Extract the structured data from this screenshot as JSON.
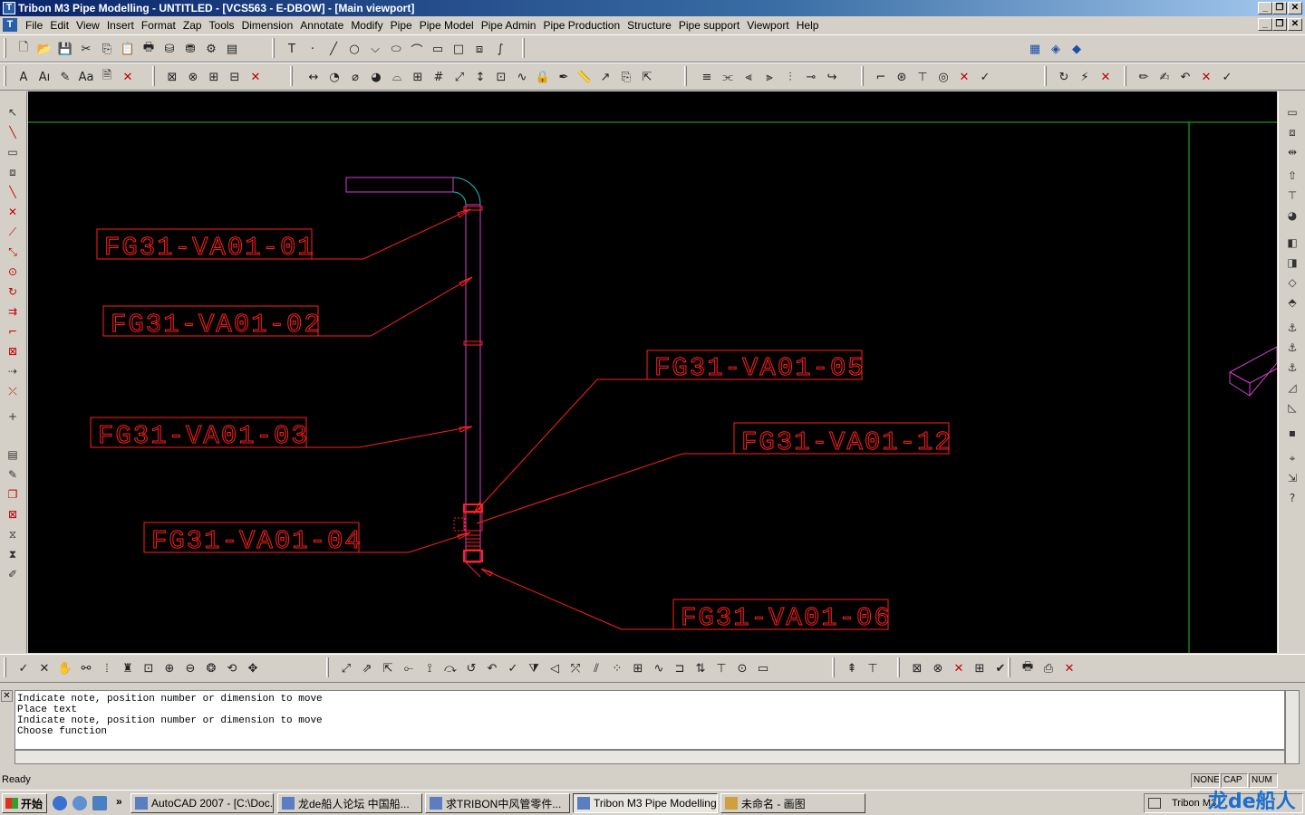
{
  "window": {
    "title": "Tribon M3 Pipe Modelling - UNTITLED - [VCS563 - E-DBOW] - [Main viewport]",
    "min": "_",
    "restore": "❐",
    "close": "✕"
  },
  "menu": {
    "items": [
      {
        "label": "File"
      },
      {
        "label": "Edit"
      },
      {
        "label": "View"
      },
      {
        "label": "Insert"
      },
      {
        "label": "Format"
      },
      {
        "label": "Zap"
      },
      {
        "label": "Tools"
      },
      {
        "label": "Dimension"
      },
      {
        "label": "Annotate"
      },
      {
        "label": "Modify"
      },
      {
        "label": "Pipe"
      },
      {
        "label": "Pipe Model"
      },
      {
        "label": "Pipe Admin"
      },
      {
        "label": "Pipe Production"
      },
      {
        "label": "Structure"
      },
      {
        "label": "Pipe support"
      },
      {
        "label": "Viewport"
      },
      {
        "label": "Help"
      }
    ]
  },
  "drawing": {
    "labels": [
      {
        "id": "fg31-va01-01",
        "text": "FG31-VA01-01"
      },
      {
        "id": "fg31-va01-02",
        "text": "FG31-VA01-02"
      },
      {
        "id": "fg31-va01-03",
        "text": "FG31-VA01-03"
      },
      {
        "id": "fg31-va01-04",
        "text": "FG31-VA01-04"
      },
      {
        "id": "fg31-va01-05",
        "text": "FG31-VA01-05"
      },
      {
        "id": "fg31-va01-12",
        "text": "FG31-VA01-12"
      },
      {
        "id": "fg31-va01-06",
        "text": "FG31-VA01-06"
      }
    ],
    "colors": {
      "label": "#ff2020",
      "pipe": "#d040d0",
      "bend": "#20c0c0",
      "border": "#20c020",
      "background": "#000000"
    }
  },
  "command": {
    "lines": [
      "Indicate note, position number or dimension to move",
      "Place text",
      "Indicate note, position number or dimension to move",
      "Choose function"
    ]
  },
  "status": {
    "text": "Ready",
    "panes": [
      "NONE",
      "CAP",
      "NUM"
    ]
  },
  "taskbar": {
    "start": "开始",
    "tasks": [
      {
        "label": "AutoCAD 2007 - [C:\\Doc...",
        "active": false
      },
      {
        "label": "龙de船人论坛 中国船...",
        "active": false
      },
      {
        "label": "求TRIBON中风管零件...",
        "active": false
      },
      {
        "label": "Tribon M3 Pipe Modelling ...",
        "active": true
      },
      {
        "label": "未命名 - 画图",
        "active": false
      }
    ],
    "tray_text": "Tribon M3",
    "overflow": "»",
    "watermark": "龙de船人"
  }
}
